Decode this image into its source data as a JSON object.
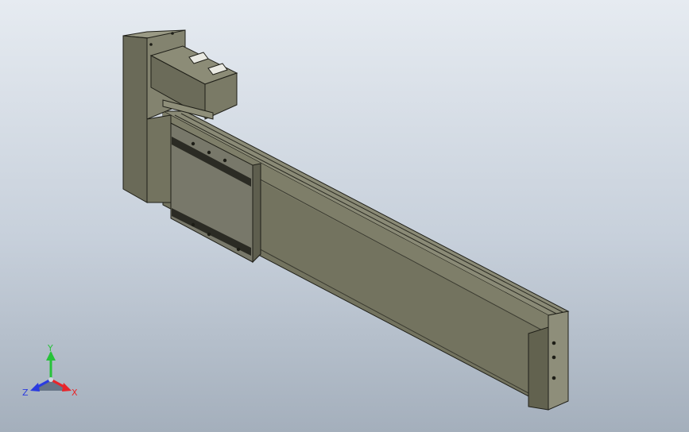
{
  "viewport": {
    "background_top": "#e6ebf1",
    "background_bottom": "#a4afbc",
    "model_color": "#6e6e5c"
  },
  "triad": {
    "x_label": "X",
    "y_label": "Y",
    "z_label": "Z",
    "x_color": "#e8252a",
    "y_color": "#27c23a",
    "z_color": "#2a3be0"
  }
}
